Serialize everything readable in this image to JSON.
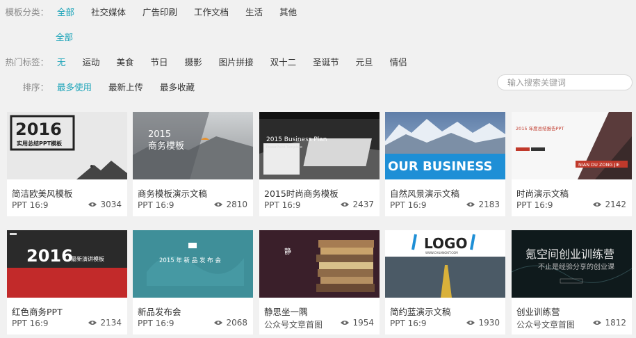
{
  "filters": {
    "category": {
      "label": "模板分类：",
      "options": [
        "全部",
        "社交媒体",
        "广告印刷",
        "工作文档",
        "生活",
        "其他"
      ]
    },
    "subcategory": {
      "options": [
        "全部"
      ]
    },
    "tags": {
      "label": "热门标签：",
      "options": [
        "无",
        "运动",
        "美食",
        "节日",
        "摄影",
        "图片拼接",
        "双十二",
        "圣诞节",
        "元旦",
        "情侣"
      ]
    },
    "sort": {
      "label": "排序：",
      "options": [
        "最多使用",
        "最新上传",
        "最多收藏"
      ]
    }
  },
  "search": {
    "placeholder": "输入搜索关键词"
  },
  "thumb_text": {
    "t1_year": "2016",
    "t1_sub": "实用总结PPT模板",
    "t2_year": "2015",
    "t2_sub": "商务模板",
    "t3_text": "2015 Business Plan",
    "t3_sub": "PowerPoint Template",
    "t4_text": "OUR BUSINESS",
    "t5_title": "2015 年度总结报告PPT",
    "t5_name": "NIAN DU ZONG JIE",
    "t6_year": "2016",
    "t6_sub": "最新演讲模板",
    "t7_text": "2015 年 新 品 发 布 会",
    "t9_logo": "LOGO",
    "t9_url": "WWW.CHUANGKIT.COM",
    "t10_main": "氪空间创业训练营",
    "t10_sub": "不止是经验分享的创业课"
  },
  "cards": [
    {
      "title": "简洁欧美风模板",
      "type": "PPT 16:9",
      "views": "3034"
    },
    {
      "title": "商务模板演示文稿",
      "type": "PPT 16:9",
      "views": "2810"
    },
    {
      "title": "2015时尚商务模板",
      "type": "PPT 16:9",
      "views": "2437"
    },
    {
      "title": "自然风景演示文稿",
      "type": "PPT 16:9",
      "views": "2183"
    },
    {
      "title": "时尚演示文稿",
      "type": "PPT 16:9",
      "views": "2142"
    },
    {
      "title": "红色商务PPT",
      "type": "PPT 16:9",
      "views": "2134"
    },
    {
      "title": "新品发布会",
      "type": "PPT 16:9",
      "views": "2068"
    },
    {
      "title": "静思坐一隅",
      "type": "公众号文章首图",
      "views": "1954"
    },
    {
      "title": "简约蓝演示文稿",
      "type": "PPT 16:9",
      "views": "1930"
    },
    {
      "title": "创业训练营",
      "type": "公众号文章首图",
      "views": "1812"
    }
  ],
  "colors": {
    "accent": "#1aa3b8",
    "background": "#f1f1f1"
  },
  "icons": {
    "views": "eye-icon"
  }
}
